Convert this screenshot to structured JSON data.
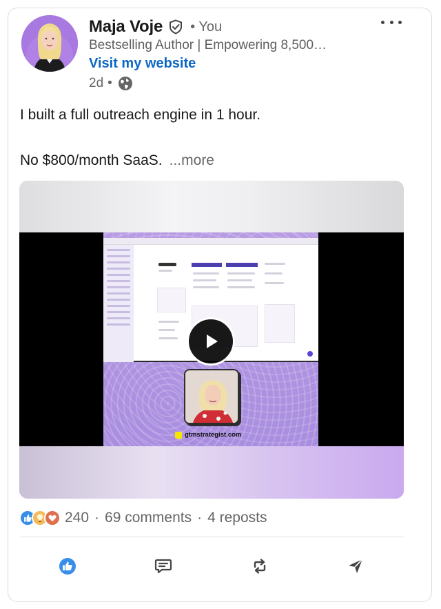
{
  "post": {
    "author_name": "Maja Voje",
    "you_label": "You",
    "you_separator": "•",
    "headline": "Bestselling Author | Empowering 8,500…",
    "website_link": "Visit my website",
    "time_ago": "2d",
    "time_separator": "•",
    "text_line1": "I built a full outreach engine in 1 hour.",
    "text_line2": "No $800/month SaaS.",
    "more_label": "...more"
  },
  "video": {
    "brand_text": "gtmstrategist.com"
  },
  "social": {
    "reaction_count": "240",
    "comments": "69 comments",
    "reposts": "4 reposts",
    "separator": "·"
  },
  "icons": {
    "verified": "shield-check-icon",
    "visibility": "globe-icon",
    "menu": "more-horizontal-icon",
    "play": "play-icon",
    "like": "like-icon",
    "comment": "comment-icon",
    "repost": "repost-icon",
    "send": "send-icon"
  },
  "colors": {
    "link": "#0a66c2",
    "like_reaction": "#378fe9",
    "insightful_reaction": "#f5bb5c",
    "love_reaction": "#df704d"
  }
}
